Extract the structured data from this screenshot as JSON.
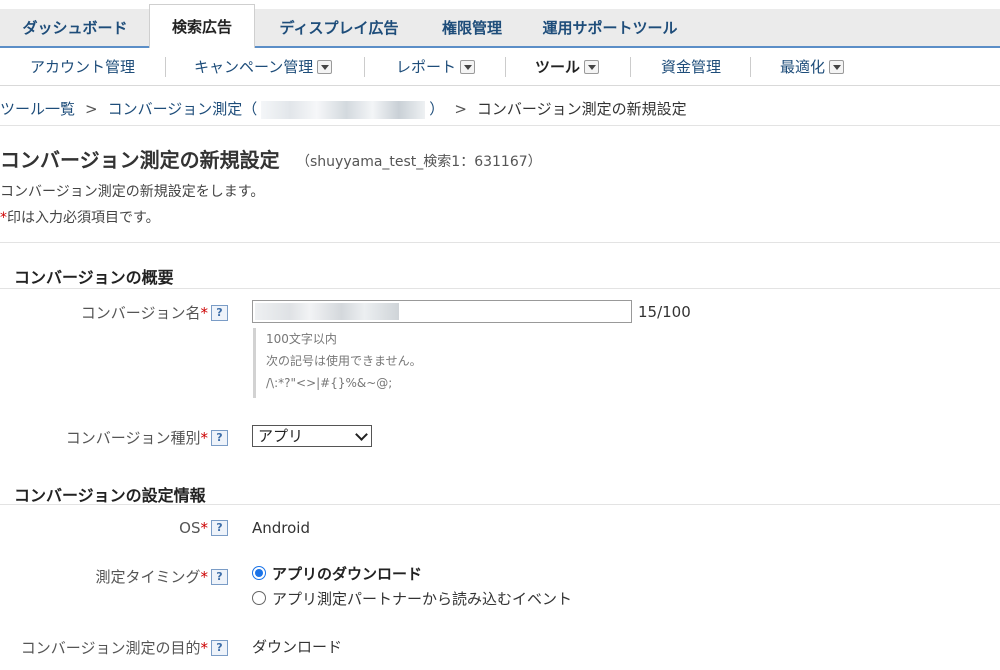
{
  "tabs": [
    {
      "label": "ダッシュボード",
      "active": false
    },
    {
      "label": "検索広告",
      "active": true
    },
    {
      "label": "ディスプレイ広告",
      "active": false
    },
    {
      "label": "権限管理",
      "active": false
    },
    {
      "label": "運用サポートツール",
      "active": false
    }
  ],
  "subnav": [
    {
      "label": "アカウント管理"
    },
    {
      "label": "キャンペーン管理"
    },
    {
      "label": "レポート"
    },
    {
      "label": "ツール"
    },
    {
      "label": "資金管理"
    },
    {
      "label": "最適化"
    }
  ],
  "breadcrumb": {
    "items": [
      "ツール一覧",
      "コンバージョン測定（",
      "）"
    ],
    "separator": ">",
    "current": "コンバージョン測定の新規設定"
  },
  "page": {
    "title": "コンバージョン測定の新規設定",
    "subtitle": "（shuyyama_test_検索1：631167）",
    "description": "コンバージョン測定の新規設定をします。",
    "required_mark": "*",
    "required_note": "印は入力必須項目です。"
  },
  "help_icon": "?",
  "section_overview": {
    "title": "コンバージョンの概要",
    "name_label": "コンバージョン名",
    "name_counter": "15/100",
    "name_hints": [
      "100文字以内",
      "次の記号は使用できません。",
      "/\\:*?\"<>|#{}%&~@;"
    ],
    "type_label": "コンバージョン種別",
    "type_selected": "アプリ"
  },
  "section_settings": {
    "title": "コンバージョンの設定情報",
    "os_label": "OS",
    "os_value": "Android",
    "timing_label": "測定タイミング",
    "timing_options": [
      {
        "label": "アプリのダウンロード",
        "checked": true
      },
      {
        "label": "アプリ測定パートナーから読み込むイベント",
        "checked": false
      }
    ],
    "purpose_label": "コンバージョン測定の目的",
    "purpose_value": "ダウンロード"
  },
  "colors": {
    "link": "#1e4d7a",
    "required": "#cc0000",
    "tab_underline": "#5b8ec7",
    "radio_checked": "#1a73e8"
  },
  "icons": [
    "dropdown-caret-icon",
    "help-question-icon",
    "select-chevron-icon"
  ]
}
